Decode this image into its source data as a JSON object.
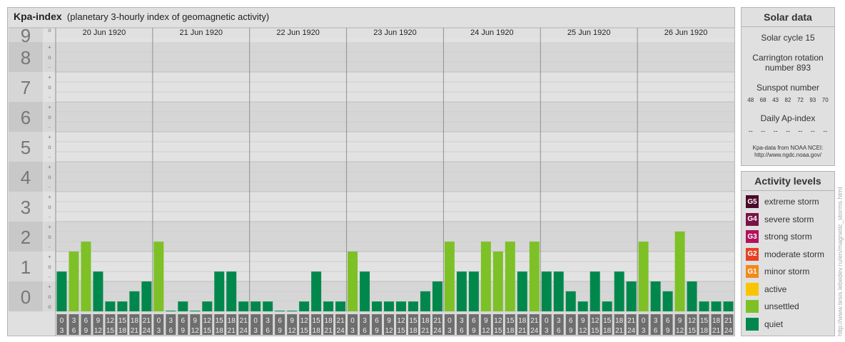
{
  "title": {
    "main": "Kpa-index",
    "sub": "(planetary 3-hourly index of geomagnetic activity)"
  },
  "colors": {
    "quiet": "#00884c",
    "unsettled": "#7dc126",
    "active": "#f9c500",
    "G1": "#f18a1c",
    "G2": "#e54124",
    "G3": "#b0145c",
    "G4": "#7a1248",
    "G5": "#4a0a2a"
  },
  "chart_data": {
    "type": "bar",
    "title": "Kpa-index",
    "ylim": [
      0,
      9
    ],
    "y_ticks": [
      "0",
      "1",
      "2",
      "3",
      "4",
      "5",
      "6",
      "7",
      "8",
      "9"
    ],
    "minor_labels": [
      "-",
      "o",
      "+"
    ],
    "days": [
      "20 Jun 1920",
      "21 Jun 1920",
      "22 Jun 1920",
      "23 Jun 1920",
      "24 Jun 1920",
      "25 Jun 1920",
      "26 Jun 1920"
    ],
    "interval_top": [
      "0",
      "3",
      "6",
      "9",
      "12",
      "15",
      "18",
      "21"
    ],
    "interval_bottom": [
      "3",
      "6",
      "9",
      "12",
      "15",
      "18",
      "21",
      "24"
    ],
    "values": [
      [
        1.33,
        2.0,
        2.33,
        1.33,
        0.33,
        0.33,
        0.67,
        1.0
      ],
      [
        2.33,
        0.0,
        0.33,
        0.0,
        0.33,
        1.33,
        1.33,
        0.33
      ],
      [
        0.33,
        0.33,
        0.0,
        0.0,
        0.33,
        1.33,
        0.33,
        0.33
      ],
      [
        2.0,
        1.33,
        0.33,
        0.33,
        0.33,
        0.33,
        0.67,
        1.0
      ],
      [
        2.33,
        1.33,
        1.33,
        2.33,
        2.0,
        2.33,
        1.33,
        2.33
      ],
      [
        1.33,
        1.33,
        0.67,
        0.33,
        1.33,
        0.33,
        1.33,
        1.0
      ],
      [
        2.33,
        1.0,
        0.67,
        2.67,
        1.0,
        0.33,
        0.33,
        0.33
      ]
    ]
  },
  "solar": {
    "title": "Solar data",
    "cycle": "Solar cycle 15",
    "carrington_line1": "Carrington rotation",
    "carrington_line2": "number 893",
    "sunspot_label": "Sunspot number",
    "sunspot_numbers": [
      "48",
      "68",
      "43",
      "82",
      "72",
      "93",
      "70"
    ],
    "ap_label": "Daily Ap-index",
    "ap_values": [
      "--",
      "--",
      "--",
      "--",
      "--",
      "--",
      "--"
    ],
    "source_line1": "Kpa-data from NOAA NCEI:",
    "source_line2": "http://www.ngdc.noaa.gov/"
  },
  "levels": {
    "title": "Activity levels",
    "items": [
      {
        "badge": "G5",
        "label": "extreme storm",
        "color": "#4a0a2a"
      },
      {
        "badge": "G4",
        "label": "severe storm",
        "color": "#7a1248"
      },
      {
        "badge": "G3",
        "label": "strong storm",
        "color": "#b0145c"
      },
      {
        "badge": "G2",
        "label": "moderate storm",
        "color": "#e54124"
      },
      {
        "badge": "G1",
        "label": "minor storm",
        "color": "#f18a1c"
      },
      {
        "badge": "",
        "label": "active",
        "color": "#f9c500"
      },
      {
        "badge": "",
        "label": "unsettled",
        "color": "#7dc126"
      },
      {
        "badge": "",
        "label": "quiet",
        "color": "#00884c"
      }
    ]
  },
  "watermark": "http://www.tesis.lebedev.ru/en/magnetic_storms.html"
}
